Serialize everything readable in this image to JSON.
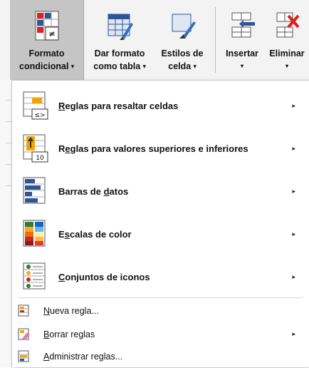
{
  "ribbon": {
    "formato_condicional": {
      "line1": "Formato",
      "line2": "condicional",
      "arrow": "▾",
      "icon": "conditional-format-icon"
    },
    "dar_formato_tabla": {
      "line1": "Dar formato",
      "line2": "como tabla",
      "arrow": "▾",
      "icon": "format-as-table-icon"
    },
    "estilos_celda": {
      "line1": "Estilos de",
      "line2": "celda",
      "arrow": "▾",
      "icon": "cell-styles-icon"
    },
    "insertar": {
      "line1": "Insertar",
      "line2": "▾",
      "icon": "insert-cells-icon"
    },
    "eliminar": {
      "line1": "Eliminar",
      "line2": "▾",
      "icon": "delete-cells-icon"
    }
  },
  "menu": {
    "items": [
      {
        "pre": "",
        "key": "R",
        "post": "eglas para resaltar celdas",
        "submenu": "▸",
        "icon": "highlight-cells-rules-icon"
      },
      {
        "pre": "R",
        "key": "e",
        "post": "glas para valores superiores e inferiores",
        "submenu": "▸",
        "icon": "top-bottom-rules-icon"
      },
      {
        "pre": "Barras de ",
        "key": "d",
        "post": "atos",
        "submenu": "▸",
        "icon": "data-bars-icon"
      },
      {
        "pre": "E",
        "key": "s",
        "post": "calas de color",
        "submenu": "▸",
        "icon": "color-scales-icon"
      },
      {
        "pre": "",
        "key": "C",
        "post": "onjuntos de iconos",
        "submenu": "▸",
        "icon": "icon-sets-icon"
      }
    ],
    "small_items": [
      {
        "pre": "",
        "key": "N",
        "post": "ueva regla...",
        "submenu": "",
        "icon": "new-rule-icon"
      },
      {
        "pre": "",
        "key": "B",
        "post": "orrar reglas",
        "submenu": "▸",
        "icon": "clear-rules-icon"
      },
      {
        "pre": "",
        "key": "A",
        "post": "dministrar reglas...",
        "submenu": "",
        "icon": "manage-rules-icon"
      }
    ]
  },
  "colors": {
    "ribbon_bg": "#f3f3f3",
    "active_button_bg": "#c5c5c5",
    "menu_bg": "#ffffff",
    "accent_red": "#d9231c",
    "accent_blue": "#2f5597",
    "accent_orange": "#f0a500"
  }
}
